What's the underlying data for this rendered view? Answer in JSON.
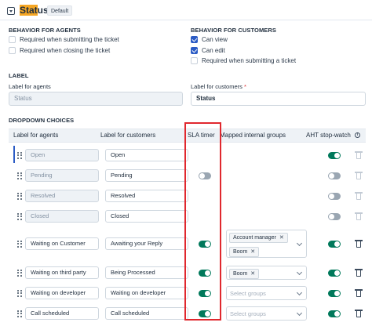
{
  "header": {
    "title_highlight": "Stat",
    "title_rest": "us",
    "badge": "Default"
  },
  "behavior_agents": {
    "title": "BEHAVIOR FOR AGENTS",
    "options": [
      {
        "label": "Required when submitting the ticket",
        "checked": false
      },
      {
        "label": "Required when closing the ticket",
        "checked": false
      }
    ]
  },
  "behavior_customers": {
    "title": "BEHAVIOR FOR CUSTOMERS",
    "options": [
      {
        "label": "Can view",
        "checked": true
      },
      {
        "label": "Can edit",
        "checked": true
      },
      {
        "label": "Required when submitting a ticket",
        "checked": false
      }
    ]
  },
  "label_section": {
    "title": "LABEL",
    "agents_label": "Label for agents",
    "agents_value": "Status",
    "customers_label": "Label for customers",
    "customers_value": "Status",
    "required_mark": "*"
  },
  "dropdown": {
    "title": "DROPDOWN CHOICES",
    "columns": {
      "agents": "Label for agents",
      "customers": "Label for customers",
      "sla": "SLA timer",
      "groups": "Mapped internal groups",
      "aht": "AHT stop-watch"
    },
    "placeholder": "Select groups",
    "rows": [
      {
        "agent": "Open",
        "customer": "Open",
        "sla": null,
        "groups": null,
        "aht": "on",
        "editable": false
      },
      {
        "agent": "Pending",
        "customer": "Pending",
        "sla": "off",
        "groups": null,
        "aht": "off",
        "editable": false
      },
      {
        "agent": "Resolved",
        "customer": "Resolved",
        "sla": null,
        "groups": null,
        "aht": "off",
        "editable": false
      },
      {
        "agent": "Closed",
        "customer": "Closed",
        "sla": null,
        "groups": null,
        "aht": "off",
        "editable": false
      },
      {
        "agent": "Waiting on Customer",
        "customer": "Awaiting your Reply",
        "sla": "on",
        "groups": [
          "Account manager",
          "Boom"
        ],
        "aht": "on",
        "editable": true
      },
      {
        "agent": "Waiting on third party",
        "customer": "Being Processed",
        "sla": "on",
        "groups": [
          "Boom"
        ],
        "aht": "on",
        "editable": true
      },
      {
        "agent": "Waiting on developer",
        "customer": "Waiting on developer",
        "sla": "on",
        "groups": [],
        "aht": "on",
        "editable": true
      },
      {
        "agent": "Call scheduled",
        "customer": "Call scheduled",
        "sla": "on",
        "groups": [],
        "aht": "on",
        "editable": true
      }
    ]
  },
  "colors": {
    "toggle_on": "#00795b",
    "toggle_off": "#9aa6b2",
    "highlight": "#f5a623",
    "sla_outline": "#e0282e"
  }
}
